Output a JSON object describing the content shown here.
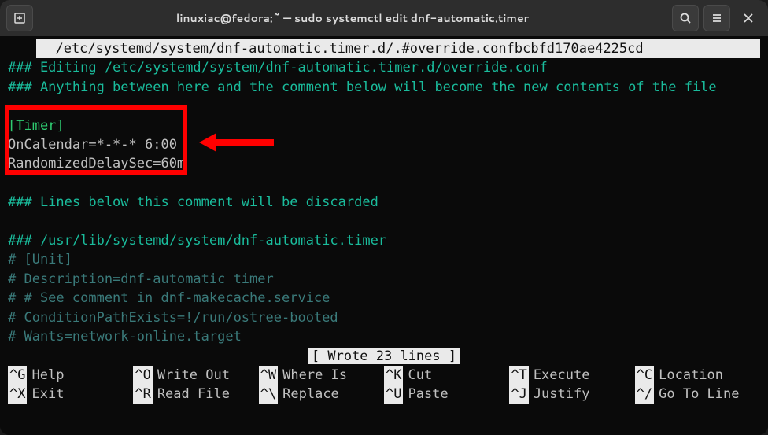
{
  "titlebar": {
    "title": "linuxiac@fedora:~ — sudo systemctl edit dnf-automatic.timer"
  },
  "editor": {
    "path_display": "  /etc/systemd/system/dnf-automatic.timer.d/.#override.confbcbfd170ae4225cd           ",
    "comment1": "### Editing /etc/systemd/system/dnf-automatic.timer.d/override.conf",
    "comment2": "### Anything between here and the comment below will become the new contents of the file",
    "section": "[Timer]",
    "line1": "OnCalendar=*-*-* 6:00",
    "line2": "RandomizedDelaySec=60m",
    "comment3": "### Lines below this comment will be discarded",
    "comment4": "### /usr/lib/systemd/system/dnf-automatic.timer",
    "c5": "# [Unit]",
    "c6": "# Description=dnf-automatic timer",
    "c7": "# # See comment in dnf-makecache.service",
    "c8": "# ConditionPathExists=!/run/ostree-booted",
    "c9": "# Wants=network-online.target",
    "status": "[ Wrote 23 lines ]"
  },
  "shortcuts": {
    "r1": [
      {
        "key": "^G",
        "label": "Help"
      },
      {
        "key": "^O",
        "label": "Write Out"
      },
      {
        "key": "^W",
        "label": "Where Is"
      },
      {
        "key": "^K",
        "label": "Cut"
      },
      {
        "key": "^T",
        "label": "Execute"
      },
      {
        "key": "^C",
        "label": "Location"
      }
    ],
    "r2": [
      {
        "key": "^X",
        "label": "Exit"
      },
      {
        "key": "^R",
        "label": "Read File"
      },
      {
        "key": "^\\",
        "label": "Replace"
      },
      {
        "key": "^U",
        "label": "Paste"
      },
      {
        "key": "^J",
        "label": "Justify"
      },
      {
        "key": "^/",
        "label": "Go To Line"
      }
    ]
  }
}
